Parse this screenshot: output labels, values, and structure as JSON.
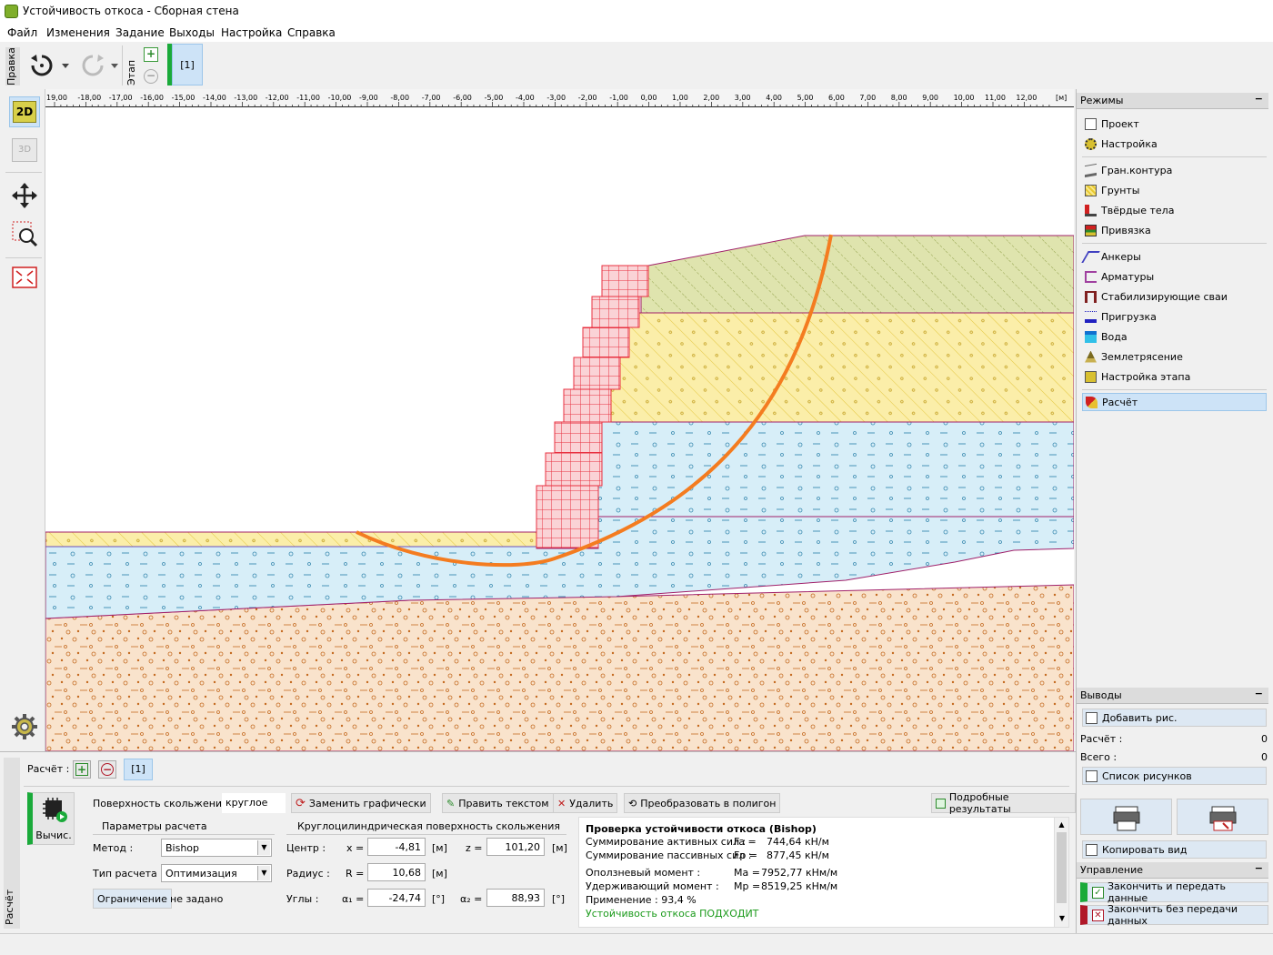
{
  "window": {
    "title": "Устойчивость откоса - Сборная стена"
  },
  "menu": [
    "Файл",
    "Изменения",
    "Задание",
    "Выходы",
    "Настройка",
    "Справка"
  ],
  "toolbar": {
    "edit_label": "Правка",
    "stage_label": "Этап",
    "stage_tab": "[1]"
  },
  "ruler": {
    "ticks": [
      "19,00",
      "-18,00",
      "-17,00",
      "-16,00",
      "-15,00",
      "-14,00",
      "-13,00",
      "-12,00",
      "-11,00",
      "-10,00",
      "-9,00",
      "-8,00",
      "-7,00",
      "-6,00",
      "-5,00",
      "-4,00",
      "-3,00",
      "-2,00",
      "-1,00",
      "0,00",
      "1,00",
      "2,00",
      "3,00",
      "4,00",
      "5,00",
      "6,00",
      "7,00",
      "8,00",
      "9,00",
      "10,00",
      "11,00",
      "12,00"
    ],
    "unit": "[м]"
  },
  "left_tools": {
    "btn_2d": "2D",
    "btn_3d": "3D"
  },
  "modes": {
    "title": "Режимы",
    "items": [
      {
        "label": "Проект",
        "icon": "document-icon"
      },
      {
        "label": "Настройка",
        "icon": "gear-icon"
      },
      {
        "label": "Гран.контура",
        "icon": "interface-icon"
      },
      {
        "label": "Грунты",
        "icon": "soil-icon"
      },
      {
        "label": "Твёрдые тела",
        "icon": "rigid-body-icon"
      },
      {
        "label": "Привязка",
        "icon": "assign-icon"
      },
      {
        "label": "Анкеры",
        "icon": "anchor-icon"
      },
      {
        "label": "Арматуры",
        "icon": "reinforcement-icon"
      },
      {
        "label": "Стабилизирующие сваи",
        "icon": "pile-icon"
      },
      {
        "label": "Пригрузка",
        "icon": "surcharge-icon"
      },
      {
        "label": "Вода",
        "icon": "water-icon"
      },
      {
        "label": "Землетрясение",
        "icon": "earthquake-icon"
      },
      {
        "label": "Настройка этапа",
        "icon": "stage-settings-icon"
      },
      {
        "label": "Расчёт",
        "icon": "analysis-icon"
      }
    ]
  },
  "outputs": {
    "title": "Выводы",
    "add_picture": "Добавить рис.",
    "analysis_label": "Расчёт :",
    "analysis_count": "0",
    "total_label": "Всего :",
    "total_count": "0",
    "picture_list": "Список рисунков",
    "copy_view": "Копировать вид"
  },
  "control": {
    "title": "Управление",
    "finish_transfer": "Закончить и передать данные",
    "finish_no_transfer": "Закончить без передачи данных"
  },
  "bottom": {
    "side_label": "Расчёт",
    "analysis_label": "Расчёт :",
    "analysis_tab": "[1]",
    "compute_label": "Вычис.",
    "slip_surface_label": "Поверхность скольжения :",
    "slip_surface_value": "круглое",
    "replace_graphically": "Заменить графически",
    "edit_text": "Править текстом",
    "delete": "Удалить",
    "convert_polygon": "Преобразовать в полигон",
    "detailed_results": "Подробные результаты",
    "params_title": "Параметры расчета",
    "method_label": "Метод :",
    "method_value": "Bishop",
    "type_label": "Тип расчета :",
    "type_value": "Оптимизация",
    "restriction_btn": "Ограничение",
    "restriction_value": "не задано",
    "circle_title": "Круглоцилиндрическая поверхность скольжения",
    "center_label": "Центр :",
    "x_label": "x =",
    "x_value": "-4,81",
    "z_label": "z =",
    "z_value": "101,20",
    "radius_label": "Радиус :",
    "r_label": "R =",
    "r_value": "10,68",
    "angles_label": "Углы :",
    "a1_label": "α₁ =",
    "a1_value": "-24,74",
    "a2_label": "α₂ =",
    "a2_value": "88,93",
    "unit_m": "[м]",
    "unit_deg": "[°]"
  },
  "results": {
    "title": "Проверка устойчивости откоса (Bishop)",
    "active_label": "Суммирование активных сил :",
    "active_sym": "Fa =",
    "active_val": "744,64 кН/м",
    "passive_label": "Суммирование пассивных сил :",
    "passive_sym": "Fp =",
    "passive_val": "877,45 кН/м",
    "sliding_label": "Оползневый момент :",
    "sliding_sym": "Ma =",
    "sliding_val": "7952,77 кНм/м",
    "resisting_label": "Удерживающий момент :",
    "resisting_sym": "Mp =",
    "resisting_val": "8519,25 кНм/м",
    "utilization": "Применение : 93,4 %",
    "verdict": "Устойчивость откоса ПОДХОДИТ",
    "verdict_color": "#1a9a1a"
  },
  "colors": {
    "slip_curve": "#f47c20",
    "wall": "#e83040",
    "soil_yellow": "#f9e79a",
    "soil_green": "#d8dfa0",
    "water_blue": "#d4ecf7",
    "soil_orange": "#f7e0c8"
  }
}
